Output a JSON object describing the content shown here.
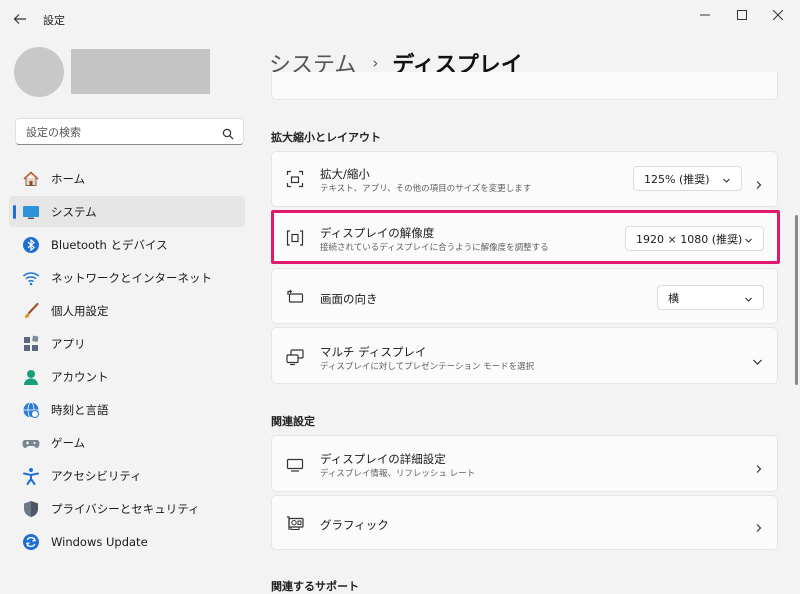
{
  "window": {
    "title": "設定"
  },
  "search": {
    "placeholder": "設定の検索"
  },
  "nav": {
    "items": [
      {
        "label": "ホーム",
        "icon": "home-icon"
      },
      {
        "label": "システム",
        "icon": "system-icon",
        "selected": true
      },
      {
        "label": "Bluetooth とデバイス",
        "icon": "bluetooth-icon"
      },
      {
        "label": "ネットワークとインターネット",
        "icon": "network-icon"
      },
      {
        "label": "個人用設定",
        "icon": "brush-icon"
      },
      {
        "label": "アプリ",
        "icon": "apps-icon"
      },
      {
        "label": "アカウント",
        "icon": "account-icon"
      },
      {
        "label": "時刻と言語",
        "icon": "globe-icon"
      },
      {
        "label": "ゲーム",
        "icon": "gamepad-icon"
      },
      {
        "label": "アクセシビリティ",
        "icon": "accessibility-icon"
      },
      {
        "label": "プライバシーとセキュリティ",
        "icon": "shield-icon"
      },
      {
        "label": "Windows Update",
        "icon": "update-icon"
      }
    ]
  },
  "breadcrumb": {
    "parent": "システム",
    "separator": "›",
    "current": "ディスプレイ"
  },
  "scale_layout": {
    "header": "拡大縮小とレイアウト",
    "scale": {
      "title": "拡大/縮小",
      "subtitle": "テキスト、アプリ、その他の項目のサイズを変更します",
      "value": "125% (推奨)"
    },
    "resolution": {
      "title": "ディスプレイの解像度",
      "subtitle": "接続されているディスプレイに合うように解像度を調整する",
      "value": "1920 × 1080 (推奨)"
    },
    "orientation": {
      "title": "画面の向き",
      "value": "横"
    },
    "multi": {
      "title": "マルチ ディスプレイ",
      "subtitle": "ディスプレイに対してプレゼンテーション モードを選択"
    }
  },
  "related": {
    "header": "関連設定",
    "advanced": {
      "title": "ディスプレイの詳細設定",
      "subtitle": "ディスプレイ情報、リフレッシュ レート"
    },
    "graphics": {
      "title": "グラフィック"
    }
  },
  "related_support": {
    "header": "関連するサポート"
  },
  "colors": {
    "accent": "#1f6fd3",
    "highlight": "#e0196c"
  }
}
